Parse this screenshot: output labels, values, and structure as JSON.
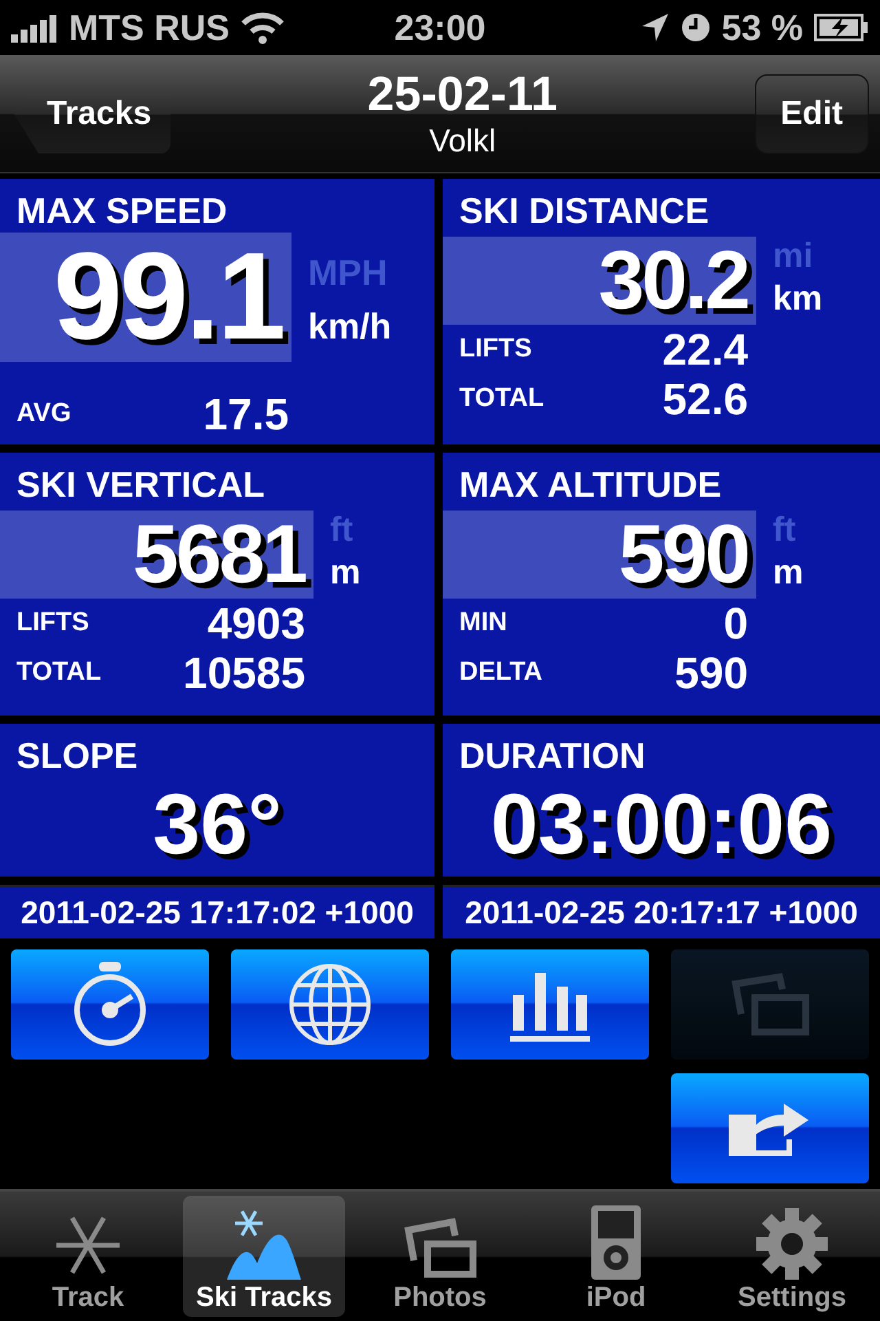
{
  "status_bar": {
    "carrier": "MTS RUS",
    "time": "23:00",
    "battery": "53 %"
  },
  "nav_bar": {
    "back": "Tracks",
    "title": "25-02-11",
    "subtitle": "Volkl",
    "action": "Edit"
  },
  "panels": [
    {
      "kind": "large",
      "label": "MAX SPEED",
      "value": "99.1",
      "units": [
        {
          "label": "MPH",
          "selected": false
        },
        {
          "label": "km/h",
          "selected": true
        }
      ],
      "rows": [
        {
          "label": "AVG",
          "value": "17.5"
        }
      ]
    },
    {
      "kind": "stat",
      "label": "SKI DISTANCE",
      "value": "30.2",
      "units": [
        {
          "label": "mi",
          "selected": false
        },
        {
          "label": "km",
          "selected": true
        }
      ],
      "rows": [
        {
          "label": "LIFTS",
          "value": "22.4"
        },
        {
          "label": "TOTAL",
          "value": "52.6"
        }
      ]
    },
    {
      "kind": "stat",
      "label": "SKI VERTICAL",
      "value": "5681",
      "units": [
        {
          "label": "ft",
          "selected": false
        },
        {
          "label": "m",
          "selected": true
        }
      ],
      "rows": [
        {
          "label": "LIFTS",
          "value": "4903"
        },
        {
          "label": "TOTAL",
          "value": "10585"
        }
      ]
    },
    {
      "kind": "stat",
      "label": "MAX ALTITUDE",
      "value": "590",
      "units": [
        {
          "label": "ft",
          "selected": false
        },
        {
          "label": "m",
          "selected": true
        }
      ],
      "rows": [
        {
          "label": "MIN",
          "value": "0"
        },
        {
          "label": "DELTA",
          "value": "590"
        }
      ]
    },
    {
      "kind": "plain",
      "label": "SLOPE",
      "value": "36°"
    },
    {
      "kind": "plain",
      "label": "DURATION",
      "value": "03:00:06"
    }
  ],
  "timestamps": [
    "2011-02-25 17:17:02 +1000",
    "2011-02-25 20:17:17 +1000"
  ],
  "buttons": [
    {
      "kind": "stopwatch",
      "disabled": false
    },
    {
      "kind": "globe",
      "disabled": false
    },
    {
      "kind": "chart",
      "disabled": false
    },
    {
      "kind": "photos",
      "disabled": true
    },
    {
      "kind": "share",
      "disabled": false
    }
  ],
  "tabs": [
    {
      "kind": "snowflake",
      "label": "Track",
      "selected": false
    },
    {
      "kind": "ski",
      "label": "Ski Tracks",
      "selected": true
    },
    {
      "kind": "photos",
      "label": "Photos",
      "selected": false
    },
    {
      "kind": "ipod",
      "label": "iPod",
      "selected": false
    },
    {
      "kind": "gear",
      "label": "Settings",
      "selected": false
    }
  ]
}
